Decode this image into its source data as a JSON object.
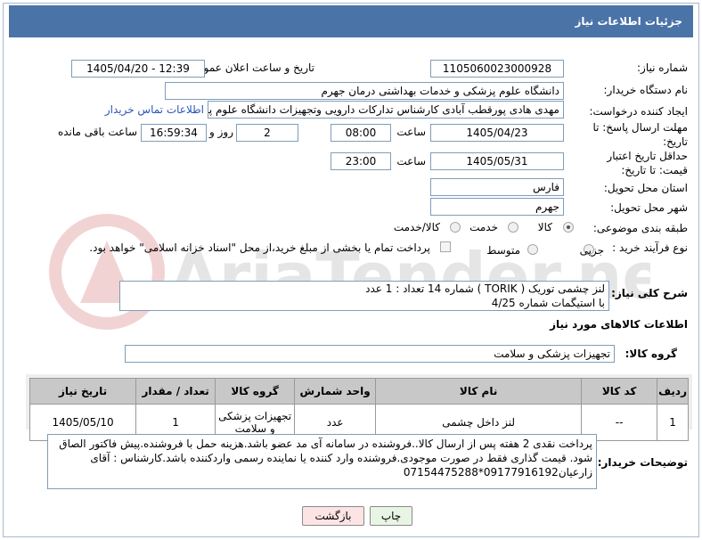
{
  "header": {
    "title": "جزئیات اطلاعات نیاز"
  },
  "form": {
    "need_number_label": "شماره نیاز:",
    "need_number": "1105060023000928",
    "announce_label": "تاریخ و ساعت اعلان عمومی:",
    "announce_value": "1405/04/20 - 12:39",
    "buyer_org_label": "نام دستگاه خریدار:",
    "buyer_org": "دانشگاه علوم پزشکی و خدمات بهداشتی  درمان جهرم",
    "requester_label": "ایجاد کننده درخواست:",
    "requester": "مهدی هادی پورقطب آبادی کارشناس تدارکات دارویی وتجهیزات دانشگاه علوم پز",
    "contact_link": "اطلاعات تماس خریدار",
    "reply_deadline_label": "مهلت ارسال پاسخ: تا تاریخ:",
    "reply_date": "1405/04/23",
    "time_label": "ساعت",
    "reply_time": "08:00",
    "days_value": "2",
    "days_label": "روز و",
    "remaining_time": "16:59:34",
    "remaining_label": "ساعت باقی مانده",
    "price_validity_label": "حداقل تاریخ اعتبار قیمت: تا تاریخ:",
    "price_date": "1405/05/31",
    "price_time_label": "ساعت",
    "price_time": "23:00",
    "province_label": "استان محل تحویل:",
    "province": "فارس",
    "city_label": "شهر محل تحویل:",
    "city": "جهرم",
    "category_label": "طبقه بندی موضوعی:",
    "category_options": [
      "کالا",
      "خدمت",
      "کالا/خدمت"
    ],
    "process_label": "نوع فرآیند خرید :",
    "process_options": [
      "جزیی",
      "متوسط"
    ],
    "payment_note": "پرداخت تمام یا بخشی از مبلغ خرید،از محل \"اسناد خزانه اسلامی\" خواهد بود."
  },
  "description": {
    "label": "شرح کلی نیاز:",
    "line1": "لنز چشمی توریک ( TORIK ) شماره 14          تعداد : 1 عدد",
    "line2": "با استیگمات شماره 4/25"
  },
  "goods_info": {
    "section_title": "اطلاعات کالاهای مورد نیاز",
    "group_label": "گروه کالا:",
    "group_value": "تجهیزات پزشکی و سلامت"
  },
  "table": {
    "headers": [
      "ردیف",
      "کد کالا",
      "نام کالا",
      "واحد شمارش",
      "گروه کالا",
      "تعداد / مقدار",
      "تاریخ نیاز"
    ],
    "rows": [
      [
        "1",
        "--",
        "لنز داخل چشمی",
        "عدد",
        "تجهیزات پزشکی و سلامت",
        "1",
        "1405/05/10"
      ]
    ]
  },
  "buyer_notes": {
    "label": "توضیحات خریدار:",
    "line1": "پرداخت نقدی 2 هفته پس از ارسال کالا..فروشنده در سامانه آی مد عضو باشد.هزینه حمل با فروشنده.پیش فاکتور الصاق",
    "line2": "شود. قیمت گذاری فقط در صورت موجودی.فروشنده وارد کننده یا نماینده رسمی واردکننده باشد.کارشناس : آقای",
    "line3": "زارعیان09177916192*07154475288"
  },
  "buttons": {
    "print": "چاپ",
    "back": "بازگشت"
  },
  "watermark": {
    "text": "AriaTender.net"
  },
  "colors": {
    "header_bg": "#4a73a8",
    "link": "#2b55b5",
    "print_btn": "#e9f5e4",
    "back_btn": "#fde4e4"
  }
}
